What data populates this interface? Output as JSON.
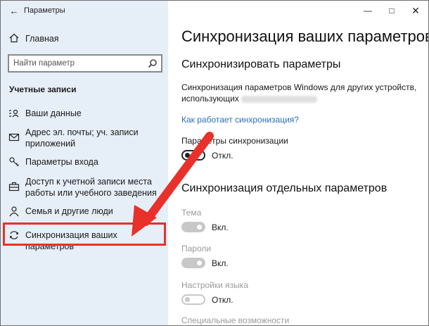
{
  "window": {
    "title": "Параметры",
    "back_icon": "back-arrow-icon",
    "controls": [
      "minimize-icon",
      "maximize-icon",
      "close-icon"
    ]
  },
  "sidebar": {
    "home_label": "Главная",
    "search_placeholder": "Найти параметр",
    "group_title": "Учетные записи",
    "items": [
      {
        "label": "Ваши данные",
        "icon": "person-card-icon"
      },
      {
        "label": "Адрес эл. почты; уч. записи приложений",
        "icon": "mail-icon"
      },
      {
        "label": "Параметры входа",
        "icon": "key-icon"
      },
      {
        "label": "Доступ к учетной записи места работы или учебного заведения",
        "icon": "briefcase-icon"
      },
      {
        "label": "Семья и другие люди",
        "icon": "person-icon"
      },
      {
        "label": "Синхронизация ваших параметров",
        "icon": "sync-icon",
        "selected": true
      }
    ]
  },
  "main": {
    "title": "Синхронизация ваших параметров",
    "section1_title": "Синхронизировать параметры",
    "description_line1": "Синхронизация параметров Windows для других устройств,",
    "description_line2": "использующих",
    "link": "Как работает синхронизация?",
    "sync_settings_label": "Параметры синхронизации",
    "sync_settings_state": "Откл.",
    "section2_title": "Синхронизация отдельных параметров",
    "items": [
      {
        "label": "Тема",
        "state": "Вкл.",
        "on": true,
        "disabled": true
      },
      {
        "label": "Пароли",
        "state": "Вкл.",
        "on": true,
        "disabled": true
      },
      {
        "label": "Настройки языка",
        "state": "Откл.",
        "on": false,
        "disabled": true
      },
      {
        "label": "Специальные возможности",
        "state": "",
        "on": false,
        "disabled": true
      }
    ]
  },
  "colors": {
    "sidebar_bg": "#e6eef7",
    "accent_link": "#2a6ebb",
    "annotation_red": "#e8312a"
  }
}
